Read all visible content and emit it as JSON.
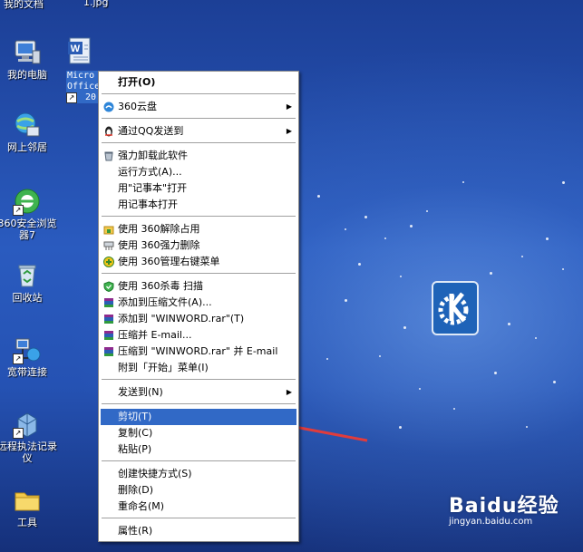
{
  "desktop": {
    "top_labels": [
      "我的文档",
      "1.jpg"
    ],
    "icons": [
      {
        "label": "我的电脑",
        "icon": "my-computer-icon"
      },
      {
        "label": "网上邻居",
        "icon": "network-places-icon"
      },
      {
        "label": "360安全浏览器7",
        "icon": "360-browser-icon"
      },
      {
        "label": "回收站",
        "icon": "recycle-bin-icon"
      },
      {
        "label": "宽带连接",
        "icon": "broadband-connection-icon"
      },
      {
        "label": "远程执法记录仪",
        "icon": "remote-recorder-icon"
      },
      {
        "label": "工具",
        "icon": "folder-icon"
      }
    ],
    "selected_file": {
      "label_line1": "Micro",
      "label_line2": "Office",
      "label_line3": "20",
      "icon": "word-document-icon"
    }
  },
  "context_menu": {
    "items": {
      "open": "打开(O)",
      "cloud360": "360云盘",
      "qq_send": "通过QQ发送到",
      "force_uninstall": "强力卸载此软件",
      "run_as": "运行方式(A)...",
      "open_notepad_quoted": "用\"记事本\"打开",
      "open_notepad": "用记事本打开",
      "unlock360": "使用 360解除占用",
      "shred360": "使用 360强力删除",
      "manage360": "使用 360管理右键菜单",
      "scan360": "使用 360杀毒 扫描",
      "add_archive": "添加到压缩文件(A)...",
      "add_winword_rar": "添加到 \"WINWORD.rar\"(T)",
      "compress_email": "压缩并 E-mail...",
      "compress_winword_email": "压缩到 \"WINWORD.rar\" 并 E-mail",
      "pin_start": "附到「开始」菜单(I)",
      "send_to": "发送到(N)",
      "cut": "剪切(T)",
      "copy": "复制(C)",
      "paste": "粘贴(P)",
      "create_shortcut": "创建快捷方式(S)",
      "delete": "删除(D)",
      "rename": "重命名(M)",
      "properties": "属性(R)"
    }
  },
  "watermark": {
    "brand": "Baidu经验",
    "url": "jingyan.baidu.com"
  },
  "colors": {
    "highlight": "#3169c6",
    "annotation_arrow": "#e03c3c",
    "kde_blue": "#1f63b8"
  }
}
